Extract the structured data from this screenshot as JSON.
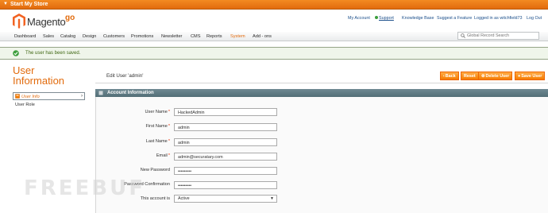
{
  "topbar": {
    "title": "Start My Store"
  },
  "header": {
    "logo_text": "Magento",
    "logo_suffix": "go",
    "links": {
      "my_account": "My Account",
      "support": "Support",
      "knowledge_base": "Knowledge Base",
      "suggest_feature": "Suggest a Feature",
      "logged_in": "Logged in as witchfield73",
      "logout": "Log Out"
    }
  },
  "nav": {
    "items": [
      "Dashboard",
      "Sales",
      "Catalog",
      "Design",
      "Customers",
      "Promotions",
      "Newsletter",
      "CMS",
      "Reports",
      "System",
      "Add - ons"
    ],
    "active_color": "#e26b0d"
  },
  "search": {
    "placeholder": "Global Record Search"
  },
  "message": {
    "text": "The user has been saved."
  },
  "sidebar": {
    "title_line1": "User",
    "title_line2": "Information",
    "tabs": [
      "User Info",
      "User Role"
    ]
  },
  "content": {
    "title": "Edit User 'admin'",
    "buttons": {
      "back": "Back",
      "reset": "Reset",
      "delete": "Delete User",
      "save": "Save User"
    }
  },
  "fieldset": {
    "title": "Account Information",
    "fields": [
      {
        "label": "User Name",
        "required": true,
        "value": "HackedAdmin"
      },
      {
        "label": "First Name",
        "required": true,
        "value": "admin"
      },
      {
        "label": "Last Name",
        "required": true,
        "value": "admin"
      },
      {
        "label": "Email",
        "required": true,
        "value": "admin@securatary.com"
      },
      {
        "label": "New Password",
        "required": false,
        "value": "•••••••••"
      },
      {
        "label": "Password Confirmation",
        "required": false,
        "value": "•••••••••"
      },
      {
        "label": "This account is",
        "required": false,
        "value": "Active"
      }
    ]
  },
  "required_mark": "*",
  "watermark": "FREEBUF"
}
